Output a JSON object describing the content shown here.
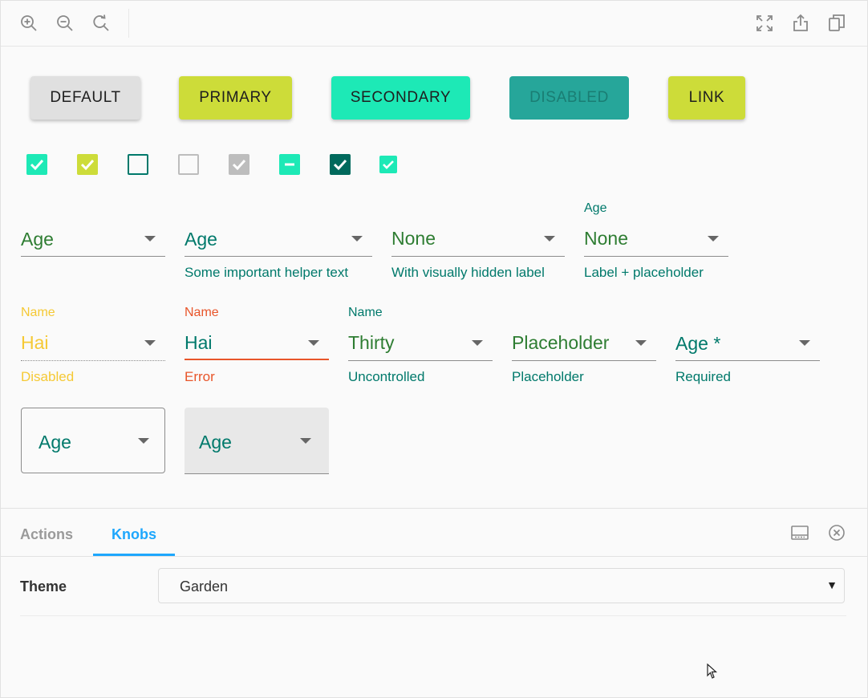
{
  "toolbar": {
    "left_icons": [
      "zoom-in-icon",
      "zoom-out-icon",
      "zoom-reset-icon"
    ],
    "right_icons": [
      "fullscreen-icon",
      "share-icon",
      "copy-icon"
    ]
  },
  "buttons": {
    "default": "Default",
    "primary": "Primary",
    "secondary": "Secondary",
    "disabled": "Disabled",
    "link": "Link"
  },
  "colors": {
    "primary": "#cddc39",
    "secondary": "#1de9b6",
    "teal": "#00796b",
    "green": "#2e7d32",
    "error": "#e8552a",
    "disabled_text": "#f5c935",
    "knobs_accent": "#1ea7fd"
  },
  "checkboxes": [
    {
      "state": "checked",
      "color": "secondary"
    },
    {
      "state": "checked",
      "color": "primary"
    },
    {
      "state": "unchecked",
      "color": "teal"
    },
    {
      "state": "unchecked",
      "color": "disabled"
    },
    {
      "state": "checked",
      "color": "disabled"
    },
    {
      "state": "indeterminate",
      "color": "secondary"
    },
    {
      "state": "checked",
      "color": "teal-dark"
    },
    {
      "state": "checked",
      "color": "secondary-small"
    }
  ],
  "selects_row1": [
    {
      "label": "",
      "value": "Age",
      "helper": ""
    },
    {
      "label": "",
      "value": "Age",
      "helper": "Some important helper text"
    },
    {
      "label": "",
      "value": "None",
      "helper": "With visually hidden label"
    },
    {
      "label": "Age",
      "value": "None",
      "helper": "Label + placeholder"
    }
  ],
  "selects_row2": [
    {
      "label": "Name",
      "value": "Hai",
      "helper": "Disabled"
    },
    {
      "label": "Name",
      "value": "Hai",
      "helper": "Error"
    },
    {
      "label": "Name",
      "value": "Thirty",
      "helper": "Uncontrolled"
    },
    {
      "label": "",
      "value": "Placeholder",
      "helper": "Placeholder"
    },
    {
      "label": "",
      "value": "Age *",
      "helper": "Required"
    }
  ],
  "selects_row3": [
    {
      "variant": "outlined",
      "value": "Age"
    },
    {
      "variant": "filled",
      "value": "Age"
    }
  ],
  "panel": {
    "tabs": [
      "Actions",
      "Knobs"
    ],
    "active_tab": "Knobs",
    "theme_label": "Theme",
    "theme_value": "Garden",
    "icons": [
      "panel-layout-icon",
      "close-panel-icon"
    ]
  }
}
